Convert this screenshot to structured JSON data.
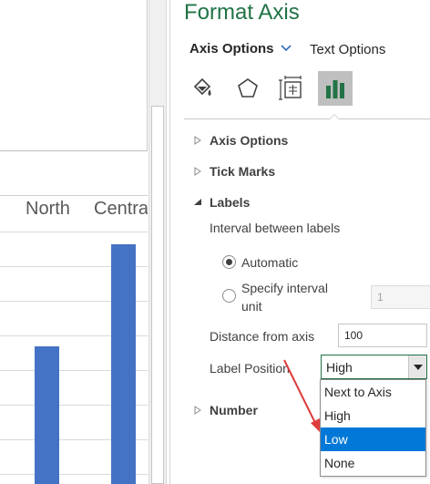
{
  "chart": {
    "categories": [
      "North",
      "Centra"
    ],
    "bar_color": "#4472c4"
  },
  "pane": {
    "title": "Format Axis",
    "tabs": {
      "axis_options": "Axis Options",
      "text_options": "Text Options"
    },
    "icons": [
      "fill-line-icon",
      "effects-icon",
      "size-properties-icon",
      "axis-options-icon"
    ],
    "sections": {
      "axis_options": "Axis Options",
      "tick_marks": "Tick Marks",
      "labels": "Labels",
      "number": "Number"
    },
    "labels": {
      "interval_heading": "Interval between labels",
      "automatic": "Automatic",
      "specify_line1": "Specify interval",
      "specify_line2": "unit",
      "specify_value": "1",
      "distance_label": "Distance from axis",
      "distance_value": "100",
      "position_label": "Label Position",
      "position_value": "High"
    },
    "dropdown": {
      "options": [
        "Next to Axis",
        "High",
        "Low",
        "None"
      ],
      "highlighted": "Low"
    },
    "accent_color": "#217346",
    "highlight_color": "#0078d7",
    "annotation_arrow_color": "#e03c3c"
  }
}
